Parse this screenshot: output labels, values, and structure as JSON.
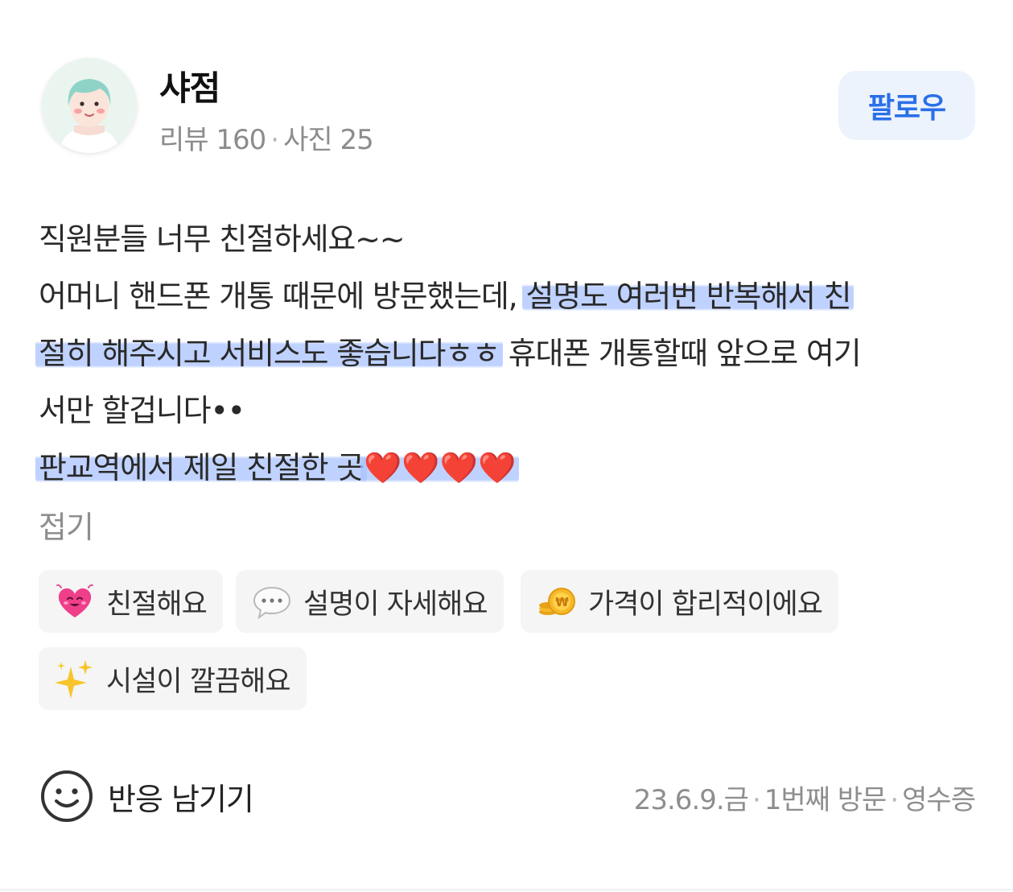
{
  "reviewer": {
    "name": "샤점",
    "stats": [
      "리뷰 160",
      "사진 25"
    ],
    "follow_label": "팔로우"
  },
  "review": {
    "lines": [
      {
        "parts": [
          {
            "text": "직원분들 너무 친절하세요~~",
            "highlight": false
          }
        ]
      },
      {
        "parts": [
          {
            "text": "어머니 핸드폰 개통 때문에 방문했는데, ",
            "highlight": false
          },
          {
            "text": "설명도 여러번 반복해서 친",
            "highlight": true
          }
        ]
      },
      {
        "parts": [
          {
            "text": "절히 해주시고 서비스도 좋습니다ㅎㅎ",
            "highlight": true
          },
          {
            "text": " 휴대폰 개통할때 앞으로 여기",
            "highlight": false
          }
        ]
      },
      {
        "parts": [
          {
            "text": "서만 할겁니다••",
            "highlight": false
          }
        ]
      },
      {
        "parts": [
          {
            "text": "판교역에서 제일 친절한 곳",
            "highlight": true
          },
          {
            "text": "❤️❤️❤️❤️",
            "highlight": true,
            "emoji": true
          }
        ]
      }
    ],
    "collapse_label": "접기"
  },
  "keywords": [
    {
      "label": "친절해요",
      "icon": "heart-face-icon"
    },
    {
      "label": "설명이 자세해요",
      "icon": "speech-bubble-icon"
    },
    {
      "label": "가격이 합리적이에요",
      "icon": "coin-icon"
    },
    {
      "label": "시설이 깔끔해요",
      "icon": "sparkles-icon"
    }
  ],
  "footer": {
    "react_label": "반응 남기기",
    "meta": [
      "23.6.9.금",
      "1번째 방문",
      "영수증"
    ]
  },
  "colors": {
    "accent": "#2b6fe8",
    "follow_bg": "#edf3fd",
    "highlight": "#aac3ff",
    "chip_bg": "#f5f5f5",
    "muted_text": "#8e8e8e"
  }
}
